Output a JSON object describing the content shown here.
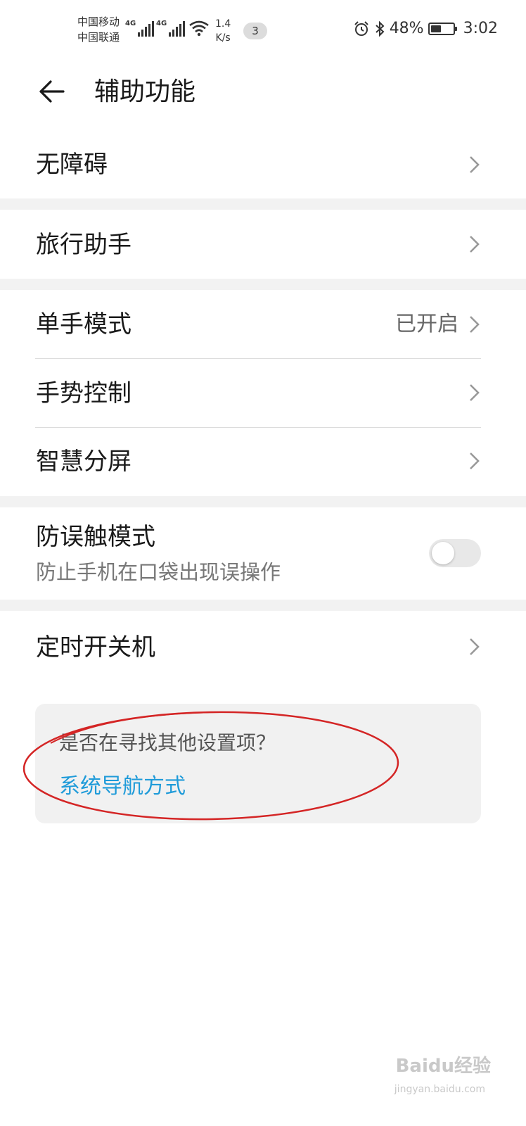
{
  "status_bar": {
    "carrier_1": "中国移动",
    "carrier_2": "中国联通",
    "network_tag_1": "4G",
    "network_tag_2": "4G",
    "speed_value": "1.4",
    "speed_unit": "K/s",
    "notification_count": "3",
    "battery_percent": "48%",
    "battery_level": 0.48,
    "time": "3:02"
  },
  "header": {
    "title": "辅助功能"
  },
  "settings": {
    "accessibility": "无障碍",
    "travel_assistant": "旅行助手",
    "one_hand_mode": "单手模式",
    "one_hand_mode_status": "已开启",
    "gesture_control": "手势控制",
    "smart_split_screen": "智慧分屏",
    "pocket_mode": "防误触模式",
    "pocket_mode_desc": "防止手机在口袋出现误操作",
    "pocket_mode_enabled": false,
    "scheduled_power": "定时开关机"
  },
  "suggestion": {
    "question": "是否在寻找其他设置项？",
    "link": "系统导航方式"
  },
  "watermark": {
    "brand": "Baidu经验",
    "url": "jingyan.baidu.com"
  }
}
